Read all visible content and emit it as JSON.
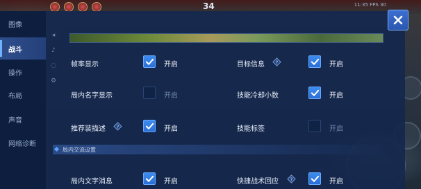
{
  "hud": {
    "score": "34",
    "right_text": "11:35  FPS 30"
  },
  "sidebar": {
    "items": [
      {
        "label": "图像",
        "active": false
      },
      {
        "label": "战斗",
        "active": true
      },
      {
        "label": "操作",
        "active": false
      },
      {
        "label": "布局",
        "active": false
      },
      {
        "label": "声音",
        "active": false
      },
      {
        "label": "网络诊断",
        "active": false
      }
    ]
  },
  "settings": [
    {
      "label": "帧率显示",
      "state": "开启",
      "checked": true
    },
    {
      "label": "目标信息",
      "state": "开启",
      "checked": true,
      "info": true
    },
    {
      "label": "局内名字显示",
      "state": "开启",
      "checked": false
    },
    {
      "label": "技能冷却小数",
      "state": "开启",
      "checked": true
    },
    {
      "label": "推荐装描述",
      "state": "开启",
      "checked": true,
      "info": true
    },
    {
      "label": "技能标签",
      "state": "开启",
      "checked": false
    }
  ],
  "section": {
    "title": "局内交流设置"
  },
  "section_settings": [
    {
      "label": "局内文字消息",
      "state": "开启",
      "checked": true
    },
    {
      "label": "快捷战术回应",
      "state": "开启",
      "checked": true,
      "info": true
    }
  ],
  "colors": {
    "accent": "#3d8cf0",
    "panel": "#14284e",
    "active_tab": "#2f4e8c"
  },
  "icons": {
    "close": "close-icon",
    "info": "info-icon",
    "check": "check-icon"
  }
}
